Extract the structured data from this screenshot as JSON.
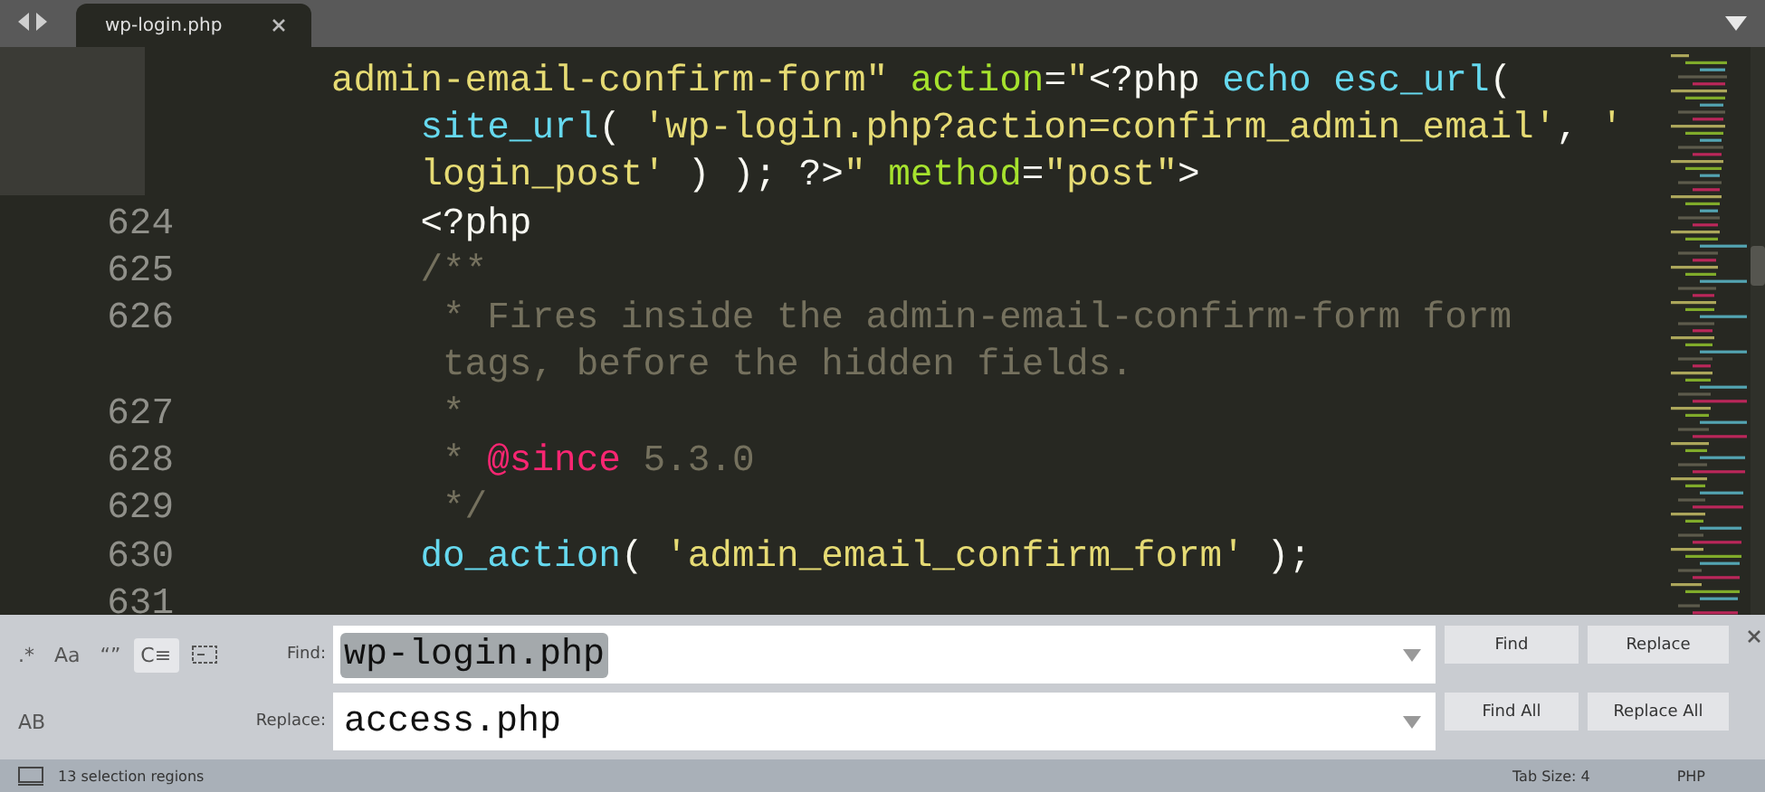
{
  "tab_bar": {
    "tabs": [
      {
        "label": "wp-login.php",
        "selected": true
      }
    ]
  },
  "editor": {
    "lines": [
      {
        "tokens": [
          {
            "kind": "string",
            "text": "admin-email-confirm-form\""
          },
          {
            "kind": "attr",
            "text": " action"
          },
          {
            "kind": "plain",
            "text": "="
          },
          {
            "kind": "string",
            "text": "\""
          },
          {
            "kind": "plain",
            "text": "<?php "
          },
          {
            "kind": "func",
            "text": "echo esc_url"
          },
          {
            "kind": "plain",
            "text": "("
          }
        ]
      },
      {
        "tokens": [
          {
            "kind": "func",
            "text": "    site_url"
          },
          {
            "kind": "plain",
            "text": "( "
          },
          {
            "kind": "string",
            "text": "'wp-login.php?action=confirm_admin_email'"
          },
          {
            "kind": "plain",
            "text": ", "
          },
          {
            "kind": "string",
            "text": "'"
          }
        ]
      },
      {
        "tokens": [
          {
            "kind": "string",
            "text": "    login_post'"
          },
          {
            "kind": "plain",
            "text": " ) ); ?>"
          },
          {
            "kind": "string",
            "text": "\" "
          },
          {
            "kind": "attr",
            "text": "method"
          },
          {
            "kind": "plain",
            "text": "="
          },
          {
            "kind": "string",
            "text": "\"post\""
          },
          {
            "kind": "plain",
            "text": ">"
          }
        ]
      },
      {
        "number": "624",
        "tokens": [
          {
            "kind": "plain",
            "text": "    <?php"
          }
        ]
      },
      {
        "number": "625",
        "tokens": [
          {
            "kind": "comment",
            "text": "    /**"
          }
        ]
      },
      {
        "number": "626",
        "tokens": [
          {
            "kind": "comment",
            "text": "     * Fires inside the admin-email-confirm-form form"
          }
        ]
      },
      {
        "tokens": [
          {
            "kind": "comment",
            "text": "     tags, before the hidden fields."
          }
        ]
      },
      {
        "number": "627",
        "tokens": [
          {
            "kind": "comment",
            "text": "     *"
          }
        ]
      },
      {
        "number": "628",
        "tokens": [
          {
            "kind": "comment",
            "text": "     * "
          },
          {
            "kind": "keyword",
            "text": "@since"
          },
          {
            "kind": "comment",
            "text": " 5.3.0"
          }
        ]
      },
      {
        "number": "629",
        "tokens": [
          {
            "kind": "comment",
            "text": "     */"
          }
        ]
      },
      {
        "number": "630",
        "tokens": [
          {
            "kind": "func",
            "text": "    do_action"
          },
          {
            "kind": "plain",
            "text": "( "
          },
          {
            "kind": "string",
            "text": "'admin_email_confirm_form'"
          },
          {
            "kind": "plain",
            "text": " );"
          }
        ]
      },
      {
        "number": "631"
      }
    ]
  },
  "find_panel": {
    "toggles": [
      {
        "kind": "regex",
        "label": ".*",
        "on": false
      },
      {
        "kind": "case",
        "label": "Aa",
        "on": false
      },
      {
        "kind": "word",
        "label": "“”",
        "on": false
      },
      {
        "kind": "wrap",
        "label": "C≡",
        "on": true
      },
      {
        "kind": "selection",
        "on": false
      },
      {
        "kind": "preserve",
        "label": "AB",
        "on": false
      }
    ],
    "find": {
      "label": "Find:",
      "value": "wp-login.php",
      "text_selected": true
    },
    "replace": {
      "label": "Replace:",
      "value": "access.php",
      "text_selected": false
    },
    "buttons": [
      "Find",
      "Replace",
      "Find All",
      "Replace All"
    ]
  },
  "status_bar": {
    "message": "13 selection regions",
    "tab_size": "Tab Size: 4",
    "syntax": "PHP"
  }
}
